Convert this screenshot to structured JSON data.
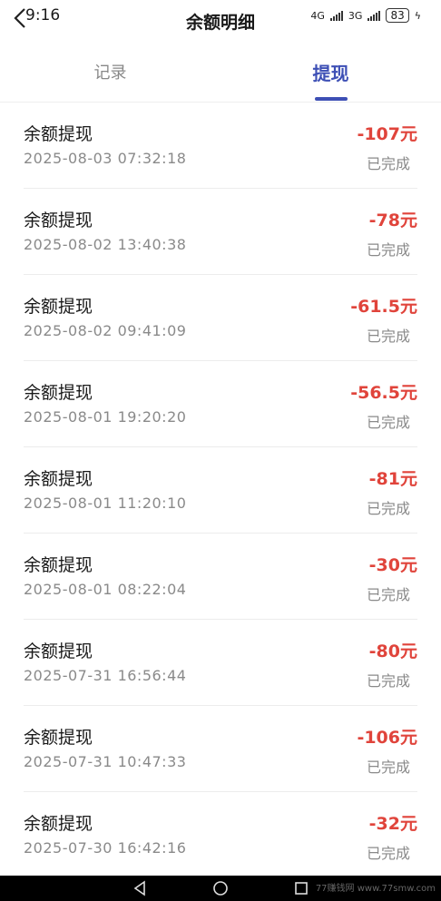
{
  "status": {
    "time": "9:16",
    "net1": "4G",
    "net2": "3G",
    "battery": "83"
  },
  "header": {
    "title": "余额明细"
  },
  "tabs": [
    {
      "label": "记录",
      "active": false
    },
    {
      "label": "提现",
      "active": true
    }
  ],
  "records": [
    {
      "title": "余额提现",
      "time": "2025-08-03 07:32:18",
      "amount": "-107元",
      "status": "已完成"
    },
    {
      "title": "余额提现",
      "time": "2025-08-02 13:40:38",
      "amount": "-78元",
      "status": "已完成"
    },
    {
      "title": "余额提现",
      "time": "2025-08-02 09:41:09",
      "amount": "-61.5元",
      "status": "已完成"
    },
    {
      "title": "余额提现",
      "time": "2025-08-01 19:20:20",
      "amount": "-56.5元",
      "status": "已完成"
    },
    {
      "title": "余额提现",
      "time": "2025-08-01 11:20:10",
      "amount": "-81元",
      "status": "已完成"
    },
    {
      "title": "余额提现",
      "time": "2025-08-01 08:22:04",
      "amount": "-30元",
      "status": "已完成"
    },
    {
      "title": "余额提现",
      "time": "2025-07-31 16:56:44",
      "amount": "-80元",
      "status": "已完成"
    },
    {
      "title": "余额提现",
      "time": "2025-07-31 10:47:33",
      "amount": "-106元",
      "status": "已完成"
    },
    {
      "title": "余额提现",
      "time": "2025-07-30 16:42:16",
      "amount": "-32元",
      "status": "已完成"
    }
  ],
  "colors": {
    "accent": "#3d4fb5",
    "amount": "#e0443b",
    "muted": "#8a8a8a"
  },
  "watermark": "77赚钱网 www.77smw.com",
  "nav_icons": [
    "back-triangle-icon",
    "home-circle-icon",
    "recents-square-icon"
  ]
}
